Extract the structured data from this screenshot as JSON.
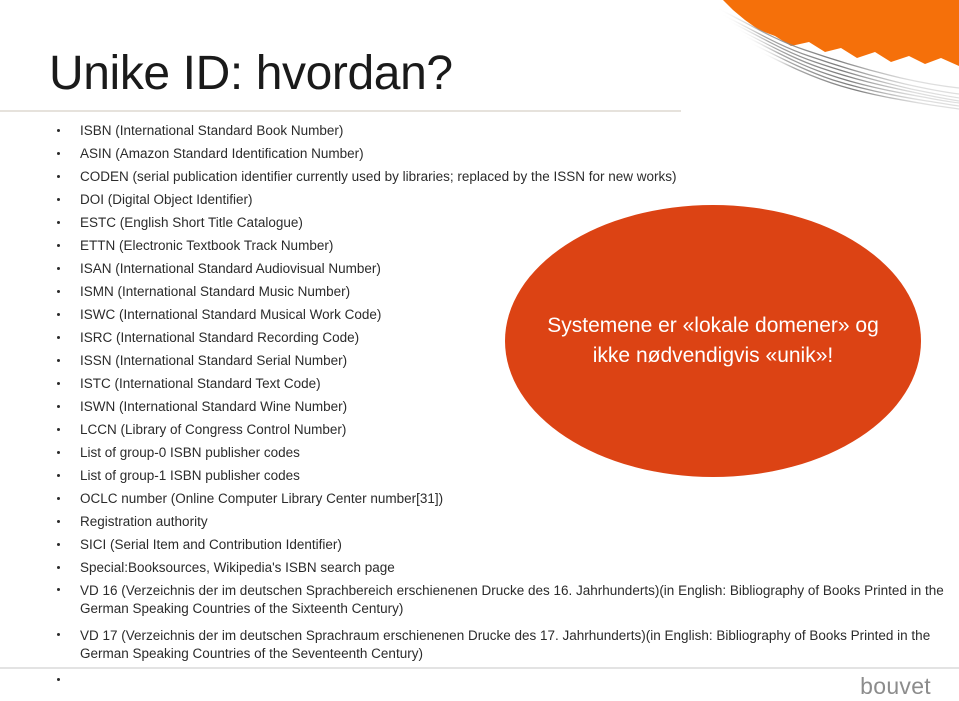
{
  "slide": {
    "title": "Unike ID: hvordan?",
    "logo": "bouvet"
  },
  "colors": {
    "corner_orange": "#F5700A",
    "callout_orange": "#DC4314",
    "title_rule": "#e6e2dc",
    "footer_rule": "#e3e3e3",
    "body_text": "#2b2b2b",
    "logo_grey": "#8c8c8c"
  },
  "bullets": [
    {
      "text": "ISBN (International Standard Book Number)",
      "group": "a"
    },
    {
      "text": "ASIN (Amazon Standard Identification Number)",
      "group": "a"
    },
    {
      "text": "CODEN (serial publication identifier currently used by libraries; replaced by the ISSN for new works)",
      "group": "a"
    },
    {
      "text": "DOI (Digital Object Identifier)",
      "group": "a"
    },
    {
      "text": "ESTC (English Short Title Catalogue)",
      "group": "a"
    },
    {
      "text": "ETTN (Electronic Textbook Track Number)",
      "group": "a"
    },
    {
      "text": "ISAN (International Standard Audiovisual Number)",
      "group": "a"
    },
    {
      "text": "ISMN (International Standard Music Number)",
      "group": "a"
    },
    {
      "text": "ISWC (International Standard Musical Work Code)",
      "group": "a"
    },
    {
      "text": "ISRC (International Standard Recording Code)",
      "group": "a"
    },
    {
      "text": "ISSN (International Standard Serial Number)",
      "group": "a"
    },
    {
      "text": "ISTC (International Standard Text Code)",
      "group": "a"
    },
    {
      "text": "ISWN (International Standard Wine Number)",
      "group": "a"
    },
    {
      "text": "LCCN (Library of Congress Control Number)",
      "group": "a"
    },
    {
      "text": "List of group-0 ISBN publisher codes",
      "group": "a"
    },
    {
      "text": "List of group-1 ISBN publisher codes",
      "group": "a"
    },
    {
      "text": "OCLC number (Online Computer Library Center number[31])",
      "group": "a"
    },
    {
      "text": "Registration authority",
      "group": "a"
    },
    {
      "text": "SICI (Serial Item and Contribution Identifier)",
      "group": "a"
    },
    {
      "text": "Special:Booksources, Wikipedia's ISBN search page",
      "group": "a"
    },
    {
      "text": "VD 16 (Verzeichnis der im deutschen Sprachbereich erschienenen Drucke des 16. Jahrhunderts)(in English: Bibliography of Books Printed in the German Speaking Countries of the Sixteenth Century)",
      "group": "b"
    },
    {
      "text": "VD 17 (Verzeichnis der im deutschen Sprachraum erschienenen Drucke des 17. Jahrhunderts)(in English: Bibliography of Books Printed in the German Speaking Countries of the Seventeenth Century)",
      "group": "b"
    },
    {
      "text": "",
      "group": "empty"
    }
  ],
  "callout": {
    "line1": "Systemene er «lokale domener»  og",
    "line2": "ikke nødvendigvis «unik»!"
  }
}
